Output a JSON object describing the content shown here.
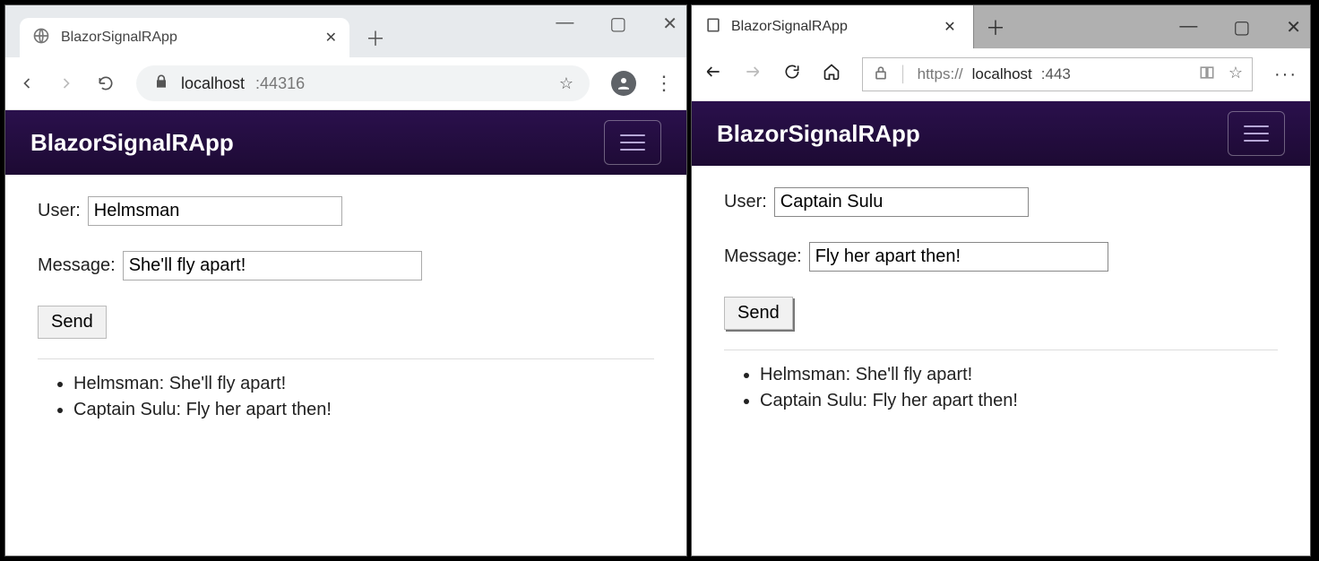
{
  "left": {
    "browser": "chrome",
    "tab_title": "BlazorSignalRApp",
    "address_host": "localhost",
    "address_port": ":44316",
    "app_title": "BlazorSignalRApp",
    "user_label": "User:",
    "user_value": "Helmsman",
    "message_label": "Message:",
    "message_value": "She'll fly apart!",
    "send_label": "Send",
    "messages": [
      "Helmsman: She'll fly apart!",
      "Captain Sulu: Fly her apart then!"
    ]
  },
  "right": {
    "browser": "edge",
    "tab_title": "BlazorSignalRApp",
    "address_scheme": "https://",
    "address_host": "localhost",
    "address_port": ":443",
    "app_title": "BlazorSignalRApp",
    "user_label": "User:",
    "user_value": "Captain Sulu",
    "message_label": "Message:",
    "message_value": "Fly her apart then!",
    "send_label": "Send",
    "messages": [
      "Helmsman: She'll fly apart!",
      "Captain Sulu: Fly her apart then!"
    ]
  }
}
